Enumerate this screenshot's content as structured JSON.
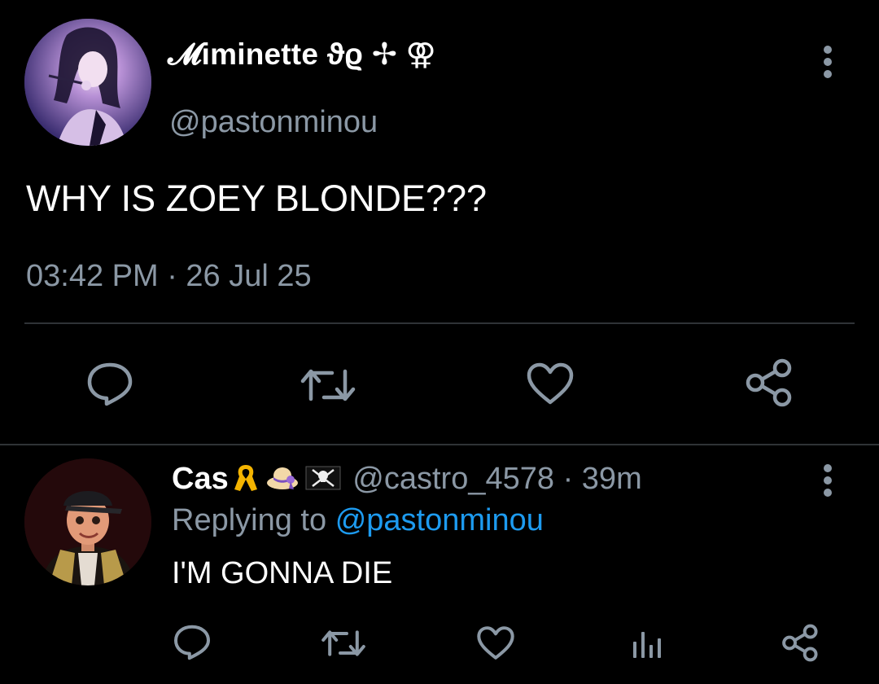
{
  "main_tweet": {
    "display_name": "𝓜iminette ϑϱ ✢ ⚢",
    "handle": "@pastonminou",
    "text": "WHY IS ZOEY BLONDE???",
    "timestamp": "03:42 PM · 26 Jul 25",
    "actions": [
      "reply-icon",
      "retweet-icon",
      "like-icon",
      "share-icon"
    ]
  },
  "reply": {
    "display_name": "Cas",
    "emojis": [
      "yellow-ribbon",
      "womans-hat",
      "pirate-flag"
    ],
    "handle": "@castro_4578",
    "separator": " · ",
    "time_ago": "39m",
    "replying_prefix": "Replying to",
    "replying_handle": "@pastonminou",
    "text": "I'M GONNA DIE",
    "actions": [
      "reply-icon",
      "retweet-icon",
      "like-icon",
      "analytics-icon",
      "share-icon"
    ]
  },
  "colors": {
    "background": "#000000",
    "text": "#ffffff",
    "secondary": "#8b98a5",
    "link": "#1d9bf0",
    "divider": "#2f3336"
  }
}
